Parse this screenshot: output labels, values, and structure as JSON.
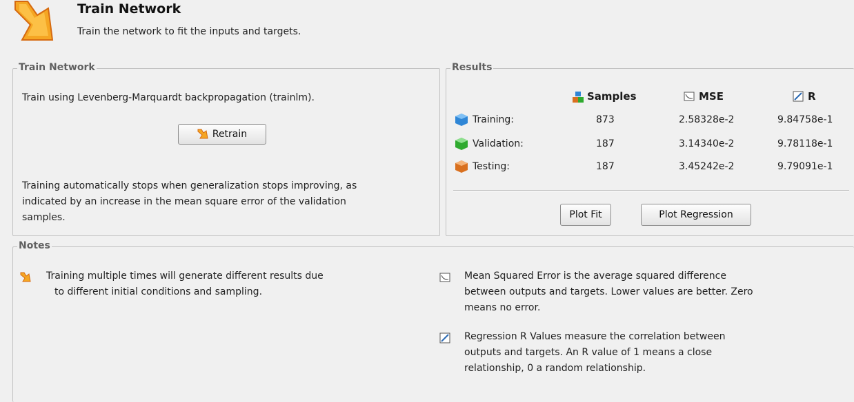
{
  "header": {
    "title": "Train Network",
    "subtitle": "Train the network to fit the inputs and targets.",
    "icon": "train-arrow-icon"
  },
  "train_panel": {
    "group_title": "Train Network",
    "description": "Train using Levenberg-Marquardt backpropagation (trainlm).",
    "retrain_label": "Retrain",
    "stop_note_lines": [
      "Training automatically stops when generalization stops improving, as",
      "indicated by an increase in the mean square error of the validation",
      "samples."
    ]
  },
  "results": {
    "group_title": "Results",
    "columns": {
      "samples": "Samples",
      "mse": "MSE",
      "r": "R"
    },
    "rows": [
      {
        "label": "Training:",
        "samples": "873",
        "mse": "2.58328e-2",
        "r": "9.84758e-1",
        "color": "#2f86d6"
      },
      {
        "label": "Validation:",
        "samples": "187",
        "mse": "3.14340e-2",
        "r": "9.78118e-1",
        "color": "#2faa2f"
      },
      {
        "label": "Testing:",
        "samples": "187",
        "mse": "3.45242e-2",
        "r": "9.79091e-1",
        "color": "#d9701f"
      }
    ],
    "plot_fit_label": "Plot Fit",
    "plot_regression_label": "Plot Regression"
  },
  "notes": {
    "group_title": "Notes",
    "training_note_lines": [
      "Training multiple times will generate different results due",
      "to different initial conditions and sampling."
    ],
    "mse_note_lines": [
      "Mean Squared Error is the average squared difference",
      "between outputs and targets. Lower values are better. Zero",
      "means no error."
    ],
    "regression_note_lines": [
      "Regression R Values measure the correlation between",
      "outputs and targets. An R value of 1 means a close",
      "relationship, 0 a random relationship."
    ]
  }
}
